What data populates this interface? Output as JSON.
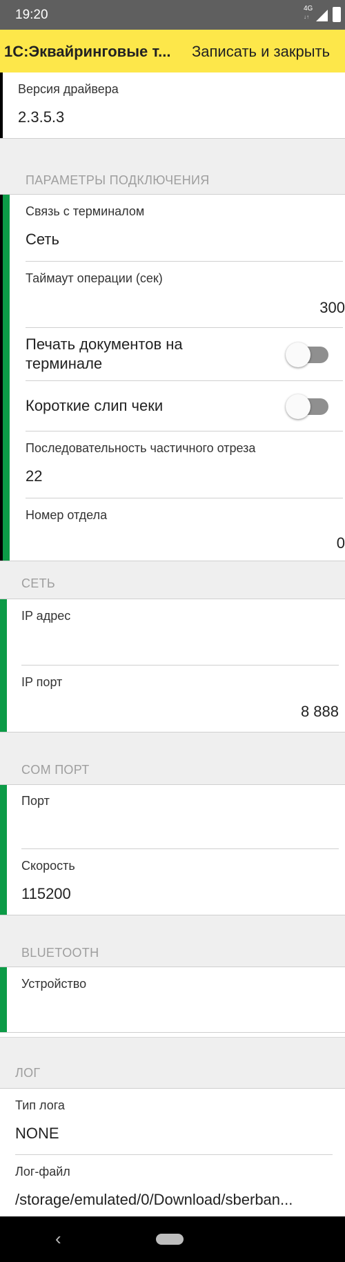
{
  "status_bar": {
    "time": "19:20",
    "network": "4G",
    "network_sub": "↓↑"
  },
  "header": {
    "title": "1С:Эквайринговые т...",
    "save_label": "Записать и закрыть"
  },
  "driver": {
    "label": "Версия драйвера",
    "value": "2.3.5.3"
  },
  "connection": {
    "section_title": "ПАРАМЕТРЫ ПОДКЛЮЧЕНИЯ",
    "link_label": "Связь с терминалом",
    "link_value": "Сеть",
    "timeout_label": "Таймаут операции (сек)",
    "timeout_value": "300",
    "print_docs_label_line1": "Печать документов на",
    "print_docs_label_line2": "терминале",
    "print_docs_on": false,
    "short_slip_label": "Короткие слип чеки",
    "short_slip_on": false,
    "cut_seq_label": "Последовательность частичного отреза",
    "cut_seq_value": "22",
    "dept_label": "Номер отдела",
    "dept_value": "0"
  },
  "network": {
    "section_title": "СЕТЬ",
    "ip_label": "IP адрес",
    "ip_value": "",
    "port_label": "IP порт",
    "port_value": "8 888"
  },
  "com_port": {
    "section_title": "COM ПОРТ",
    "port_label": "Порт",
    "port_value": "",
    "speed_label": "Скорость",
    "speed_value": "115200"
  },
  "bluetooth": {
    "section_title": "BLUETOOTH",
    "device_label": "Устройство",
    "device_value": ""
  },
  "log": {
    "section_title": "ЛОГ",
    "type_label": "Тип лога",
    "type_value": "NONE",
    "file_label": "Лог-файл",
    "file_value": "/storage/emulated/0/Download/sberban..."
  },
  "colors": {
    "header_bg": "#fde74a",
    "accent": "#0c9b47",
    "status_bar": "#5f5f5f"
  }
}
